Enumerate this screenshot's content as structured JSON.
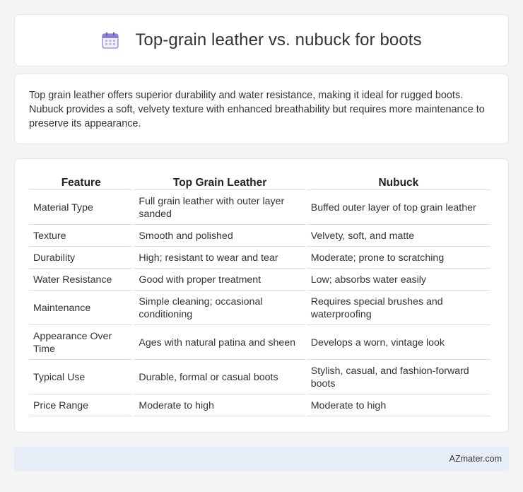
{
  "header": {
    "title": "Top-grain leather vs. nubuck for boots",
    "icon": "calendar-icon"
  },
  "intro": {
    "text": "Top grain leather offers superior durability and water resistance, making it ideal for rugged boots. Nubuck provides a soft, velvety texture with enhanced breathability but requires more maintenance to preserve its appearance."
  },
  "table": {
    "columns": [
      "Feature",
      "Top Grain Leather",
      "Nubuck"
    ],
    "rows": [
      [
        "Material Type",
        "Full grain leather with outer layer sanded",
        "Buffed outer layer of top grain leather"
      ],
      [
        "Texture",
        "Smooth and polished",
        "Velvety, soft, and matte"
      ],
      [
        "Durability",
        "High; resistant to wear and tear",
        "Moderate; prone to scratching"
      ],
      [
        "Water Resistance",
        "Good with proper treatment",
        "Low; absorbs water easily"
      ],
      [
        "Maintenance",
        "Simple cleaning; occasional conditioning",
        "Requires special brushes and waterproofing"
      ],
      [
        "Appearance Over Time",
        "Ages with natural patina and sheen",
        "Develops a worn, vintage look"
      ],
      [
        "Typical Use",
        "Durable, formal or casual boots",
        "Stylish, casual, and fashion-forward boots"
      ],
      [
        "Price Range",
        "Moderate to high",
        "Moderate to high"
      ]
    ]
  },
  "footer": {
    "brand": "AZmater.com"
  },
  "colors": {
    "background": "#f3f4f6",
    "card": "#ffffff",
    "footer": "#e8eef8",
    "icon_accent": "#7b6fd0"
  }
}
